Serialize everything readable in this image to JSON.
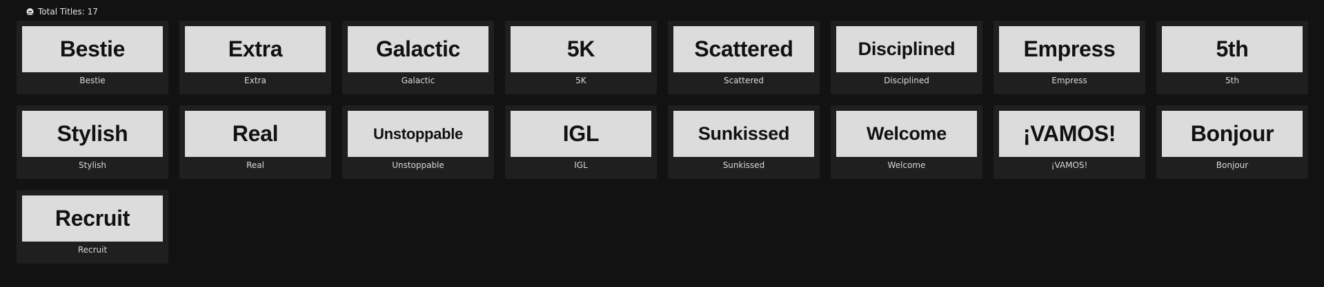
{
  "header": {
    "icon": "helmet-icon",
    "label": "Total Titles: 17"
  },
  "titles": [
    {
      "plate": "Bestie",
      "caption": "Bestie"
    },
    {
      "plate": "Extra",
      "caption": "Extra"
    },
    {
      "plate": "Galactic",
      "caption": "Galactic"
    },
    {
      "plate": "5K",
      "caption": "5K"
    },
    {
      "plate": "Scattered",
      "caption": "Scattered"
    },
    {
      "plate": "Disciplined",
      "caption": "Disciplined"
    },
    {
      "plate": "Empress",
      "caption": "Empress"
    },
    {
      "plate": "5th",
      "caption": "5th"
    },
    {
      "plate": "Stylish",
      "caption": "Stylish"
    },
    {
      "plate": "Real",
      "caption": "Real"
    },
    {
      "plate": "Unstoppable",
      "caption": "Unstoppable"
    },
    {
      "plate": "IGL",
      "caption": "IGL"
    },
    {
      "plate": "Sunkissed",
      "caption": "Sunkissed"
    },
    {
      "plate": "Welcome",
      "caption": "Welcome"
    },
    {
      "plate": "¡VAMOS!",
      "caption": "¡VAMOS!"
    },
    {
      "plate": "Bonjour",
      "caption": "Bonjour"
    },
    {
      "plate": "Recruit",
      "caption": "Recruit"
    }
  ]
}
